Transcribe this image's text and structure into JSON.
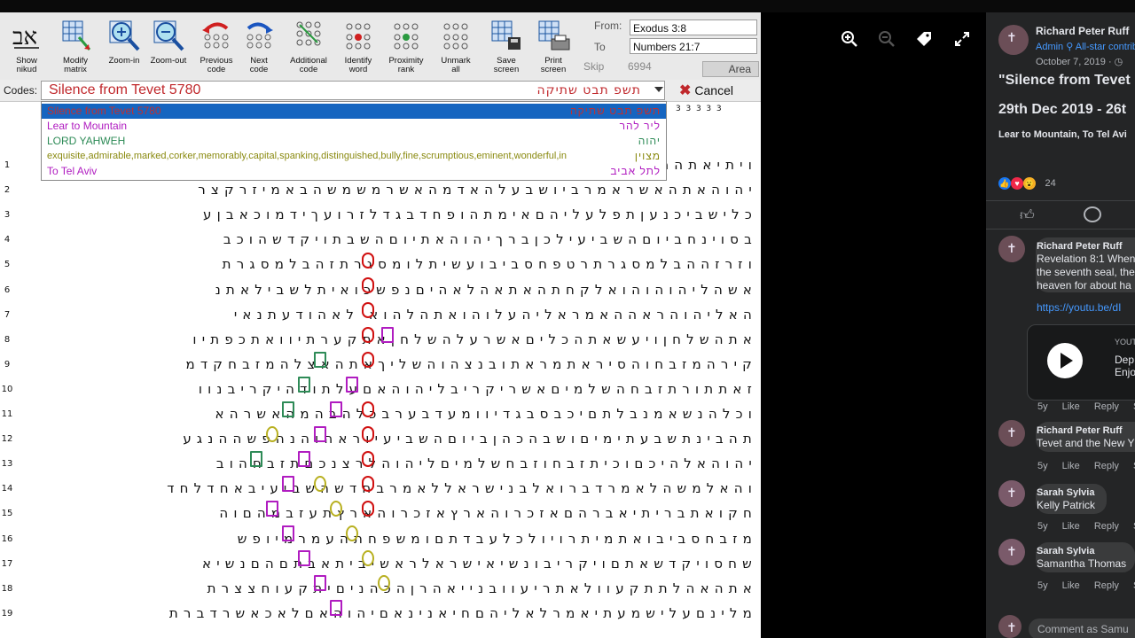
{
  "toolbar": {
    "buttons": [
      {
        "label": "Show\nnikud",
        "icon": "show-nikud-icon"
      },
      {
        "label": "Modify\nmatrix",
        "icon": "modify-matrix-icon"
      },
      {
        "label": "Zoom-in",
        "icon": "zoom-in-icon"
      },
      {
        "label": "Zoom-out",
        "icon": "zoom-out-icon"
      },
      {
        "label": "Previous\ncode",
        "icon": "previous-code-icon"
      },
      {
        "label": "Next\ncode",
        "icon": "next-code-icon"
      },
      {
        "label": "Additional\ncode",
        "icon": "additional-code-icon"
      },
      {
        "label": "Identify\nword",
        "icon": "identify-word-icon"
      },
      {
        "label": "Proximity\nrank",
        "icon": "proximity-rank-icon"
      },
      {
        "label": "Unmark\nall",
        "icon": "unmark-all-icon"
      },
      {
        "label": "Save\nscreen",
        "icon": "save-screen-icon"
      },
      {
        "label": "Print\nscreen",
        "icon": "print-screen-icon"
      }
    ],
    "from_label": "From:",
    "from_value": "Exodus 3:8",
    "to_label": "To",
    "to_value": "Numbers 21:7",
    "skip_label": "Skip",
    "skip_value": "6994",
    "area_label": "Area"
  },
  "codes": {
    "label": "Codes:",
    "value": "Silence from Tevet 5780",
    "hebrew": "תשפ תבט שתיקה",
    "cancel_label": "Cancel"
  },
  "dropdown": {
    "options": [
      {
        "label": "Silence from Tevet 5780",
        "hebrew": "תשפ תבט שתיקה",
        "color": "#c03030"
      },
      {
        "label": "Lear to Mountain",
        "hebrew": "ליר להר",
        "color": "#b01cc0"
      },
      {
        "label": "LORD YAHWEH",
        "hebrew": "יהוה",
        "color": "#2e8b57"
      },
      {
        "label": "exquisite,admirable,marked,corker,memorably,capital,spanking,distinguished,bully,fine,scrumptious,eminent,wonderful,in",
        "hebrew": "מצוין",
        "color": "#8a8a10"
      },
      {
        "label": "To Tel Aviv",
        "hebrew": "לתל אביב",
        "color": "#b01cc0"
      }
    ]
  },
  "grid": {
    "column_numbers": [
      "3",
      "3",
      "3",
      "3",
      "3",
      "3",
      "3",
      "3",
      "3",
      "3"
    ],
    "rows": [
      {
        "n": "1",
        "text": "ויתיאתהראשמראןבצשבטאראיכקשלגצרירקאלויתיאתה"
      },
      {
        "n": "2",
        "text": "יהוהאתהאשראמרביושבעלהאדמהאשרמשמשהבאמיזרקצר"
      },
      {
        "n": "3",
        "text": "כלישביכנעןתפלעליהםאימתהופחדבגדלזרועךידמוכאבןע"
      },
      {
        "n": "4",
        "text": "בסוינחביוםהשביעילכןברךיהוהאתיוםהשבתויקדשהוכב"
      },
      {
        "n": "5",
        "text": "וזרזההבלמסגרתרטפחסביבועשיתלומסגרתזהבלמסגרת"
      },
      {
        "n": "6",
        "text": "אשהליהוהוהואלקחתהאתאהלאהיםנפשכואיתלשבילאתנ"
      },
      {
        "n": "7",
        "text": "האליהוהראההאמראליהעלוהואתהלהוא לאהודעתנאי"
      },
      {
        "n": "8",
        "text": "אתהשלחןויעשאתהכליםאשרעלהשלחןאתקערתיוואתכפתיו"
      },
      {
        "n": "9",
        "text": "קירהמזבחוהסיראתמראתובנצהוהשליךאתהאצלהמזבחקדמ"
      },
      {
        "n": "10",
        "text": "זאתתורתזבחהשלמיםאשריקריבליהוהאםעלתודהיקריבנוו"
      },
      {
        "n": "11",
        "text": "וכלהנשאמנבלתםיכבסבגדיוומעדבערבכלהבהמהאשרהא"
      },
      {
        "n": "12",
        "text": "תהבינתשבעתימיםושבהכהןביוםהשביעיוראהוהנהפשההנגע"
      },
      {
        "n": "13",
        "text": "יהוהאלהיכםוכיתזבחוזבחשלמיםליהוהלרצנכםתזבחהוב"
      },
      {
        "n": "14",
        "text": "והאלמשהלאמרדברואלבנישראללאמרבחדשהשביעיבאחדלחד"
      },
      {
        "n": "15",
        "text": "חקואתבריתיאברהםאזכרוהארץאזכרוהארץתעזבמהםוה"
      },
      {
        "n": "16",
        "text": "מזבחסביבואתמיתרויולכלעבדתםומשפחתהעמרמיופש"
      },
      {
        "n": "17",
        "text": "שחסויקדשאתםויקריבונשיאישראלראשיביתאבתםהםנשיא"
      },
      {
        "n": "18",
        "text": "אתהאהלתתקעוולאתריעוובנייאהרןהכהניםיתקעוחצצרת"
      },
      {
        "n": "19",
        "text": "מלינםעלישמעתיאמרלאליהםחיאנינאםיהוהאםלאכאשרדברת"
      }
    ]
  },
  "post": {
    "author": "Richard Peter Ruff",
    "badges": "Admin  ⚲ All-star contributor",
    "date": "October 7, 2019 · ◷",
    "title_line1": "\"Silence from Tevet",
    "title_line2": "29th Dec 2019 - 26t",
    "subtitle": "Lear to Mountain, To Tel Avi",
    "reaction_count": "24"
  },
  "comments": [
    {
      "author": "Richard Peter Ruff",
      "text1": "Revelation 8:1 When",
      "text2": "the seventh seal, the",
      "text3": "heaven for about ha",
      "link": "https://youtu.be/dI",
      "time": "5y",
      "like": "Like",
      "reply": "Reply",
      "share": "Sh"
    },
    {
      "author": "Richard Peter Ruff",
      "text1": "Tevet and the New Y",
      "time": "5y",
      "like": "Like",
      "reply": "Reply",
      "share": "Sh"
    },
    {
      "author": "Sarah Sylvia",
      "text1": "Kelly Patrick",
      "time": "5y",
      "like": "Like",
      "reply": "Reply",
      "share": "Sh"
    },
    {
      "author": "Sarah Sylvia",
      "text1": "Samantha Thomas",
      "time": "5y",
      "like": "Like",
      "reply": "Reply",
      "share": "Sh"
    }
  ],
  "video_card": {
    "source": "YOUT",
    "line1": "Dep",
    "line2": "Enjo"
  },
  "comment_box": {
    "placeholder": "Comment as Samu"
  },
  "colors": {
    "red": "#d01010",
    "green": "#2e8b57",
    "purple": "#b01cc0",
    "fb_bg": "#242526",
    "fb_link": "#4599ff"
  }
}
